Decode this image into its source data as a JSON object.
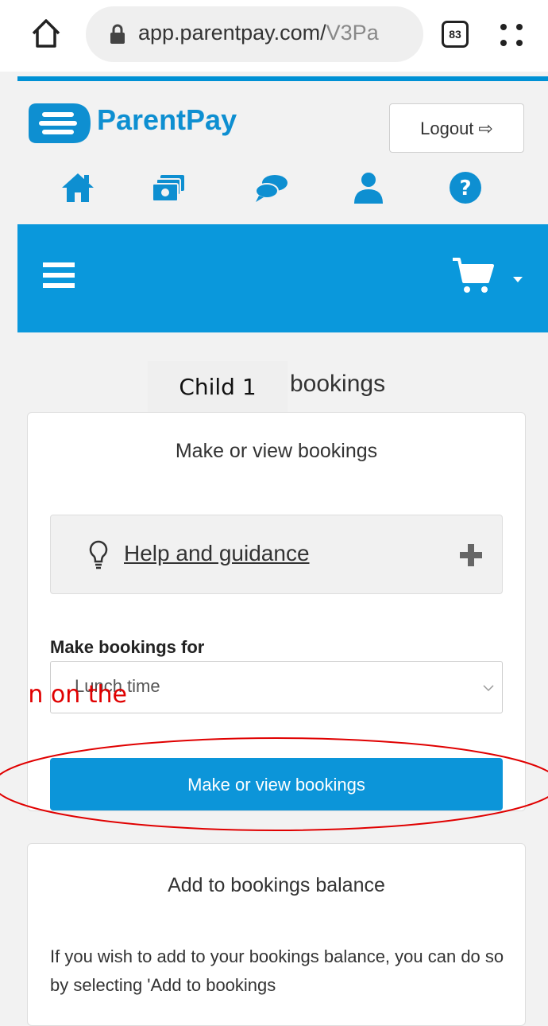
{
  "browser": {
    "url_main": "app.parentpay.com/",
    "url_dim": "V3Pa",
    "tab_count": "83"
  },
  "header": {
    "logo_text": "ParentPay",
    "logout_label": "Logout",
    "nav_icons": [
      "home-icon",
      "payments-icon",
      "messages-icon",
      "profile-icon",
      "help-icon"
    ]
  },
  "main": {
    "child_name": "Child 1",
    "title_suffix": "bookings",
    "booking_card": {
      "title": "Make or view bookings",
      "help_label": "Help and guidance",
      "field_label": "Make bookings for",
      "select_value": "Lunch time",
      "button_label": "Make or view bookings"
    },
    "balance_card": {
      "title": "Add to bookings balance",
      "description": "If you wish to add to your bookings balance, you can do so by selecting 'Add to bookings"
    }
  },
  "annotation": {
    "text": "n on the"
  },
  "colors": {
    "brand_blue": "#0a98dc",
    "annotation_red": "#e00000"
  }
}
